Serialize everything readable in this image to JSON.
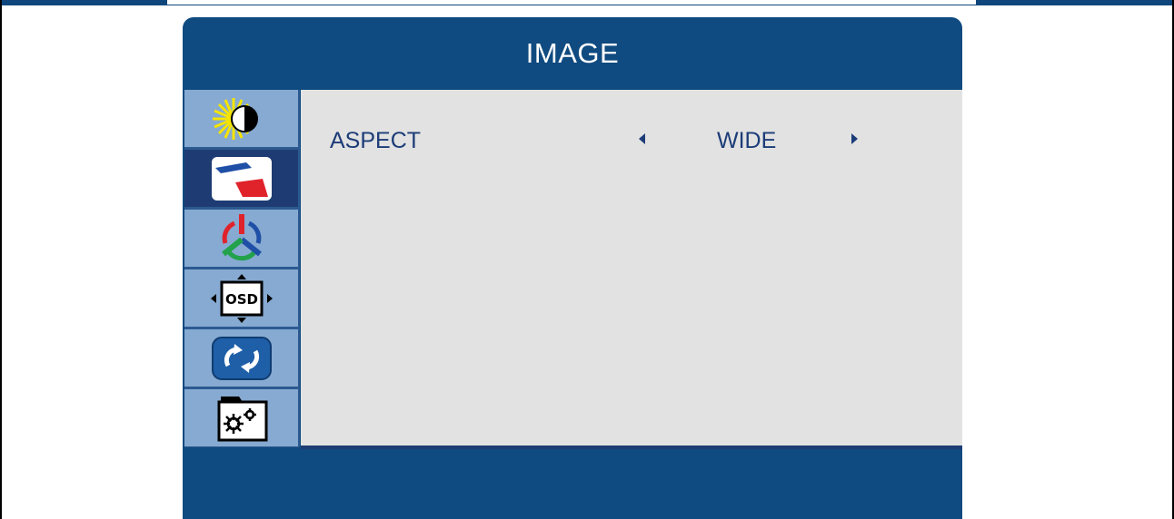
{
  "osd": {
    "title": "IMAGE",
    "menu": [
      {
        "id": "luminance",
        "icon": "brightness-contrast-icon"
      },
      {
        "id": "image",
        "icon": "image-setup-icon",
        "active": true
      },
      {
        "id": "color",
        "icon": "color-temp-icon"
      },
      {
        "id": "osd",
        "icon": "osd-setup-icon",
        "text": "OSD"
      },
      {
        "id": "reset",
        "icon": "reset-icon"
      },
      {
        "id": "extra",
        "icon": "extra-settings-icon"
      }
    ],
    "settings": [
      {
        "label": "ASPECT",
        "value": "WIDE"
      }
    ]
  },
  "colors": {
    "frame_blue": "#0f4a80",
    "sidebar_item": "#86aad1",
    "sidebar_active": "#1e3c73",
    "content_bg": "#e2e2e2",
    "text_navy": "#1c3c78"
  }
}
